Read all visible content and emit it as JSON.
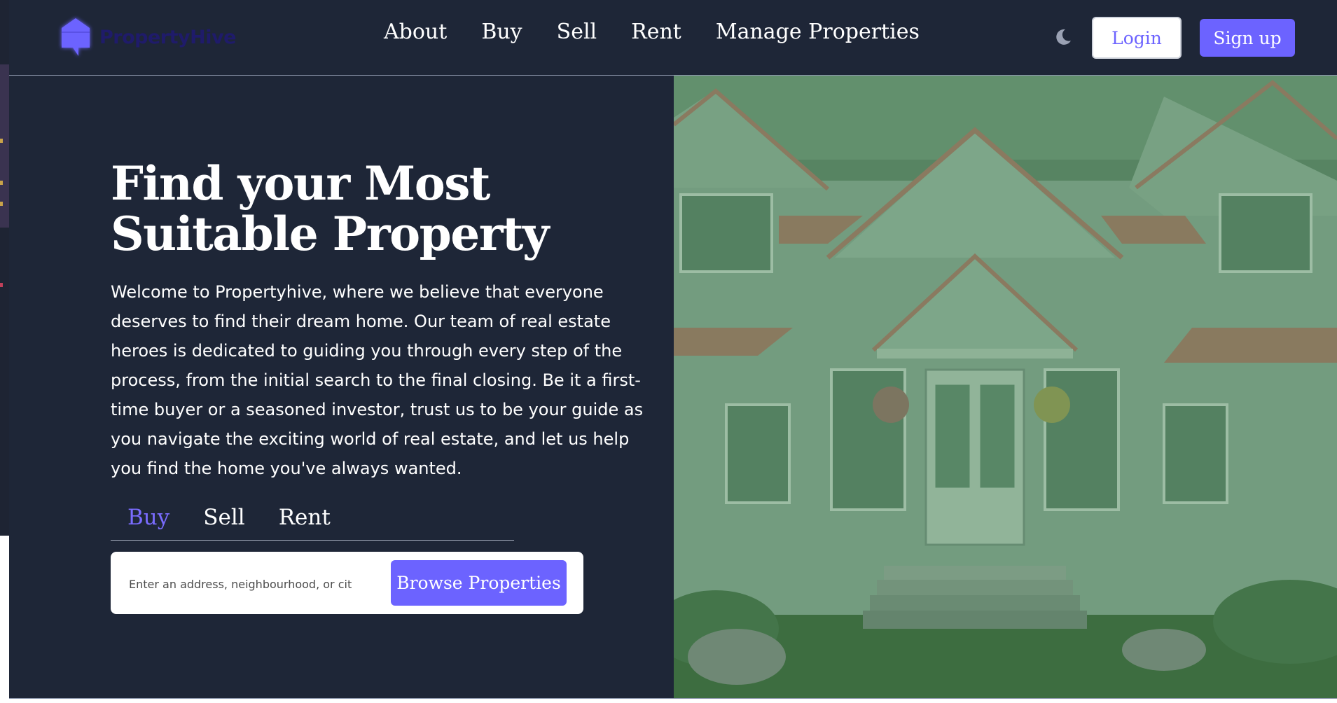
{
  "brand": {
    "name": "PropertyHive",
    "logo_icon": "house-logo-icon"
  },
  "nav": {
    "links": [
      {
        "label": "About"
      },
      {
        "label": "Buy"
      },
      {
        "label": "Sell"
      },
      {
        "label": "Rent"
      },
      {
        "label": "Manage Properties"
      }
    ]
  },
  "header_actions": {
    "theme_icon": "moon-icon",
    "login_label": "Login",
    "signup_label": "Sign up"
  },
  "hero": {
    "title": "Find your Most Suitable Property",
    "description": "Welcome to Propertyhive, where we believe that everyone deserves to find their dream home. Our team of real estate heroes is dedicated to guiding you through every step of the process, from the initial search to the final closing. Be it a first-time buyer or a seasoned investor, trust us to be your guide as you navigate the exciting world of real estate, and let us help you find the home you've always wanted.",
    "tabs": [
      {
        "label": "Buy",
        "active": true
      },
      {
        "label": "Sell",
        "active": false
      },
      {
        "label": "Rent",
        "active": false
      }
    ],
    "search": {
      "placeholder": "Enter an address, neighbourhood, or cit",
      "value": "",
      "button_label": "Browse Properties"
    },
    "image": "house-photo"
  },
  "colors": {
    "background": "#1e2637",
    "accent": "#6c63ff",
    "text": "#ffffff",
    "image_tint": "#4a8a5a"
  }
}
